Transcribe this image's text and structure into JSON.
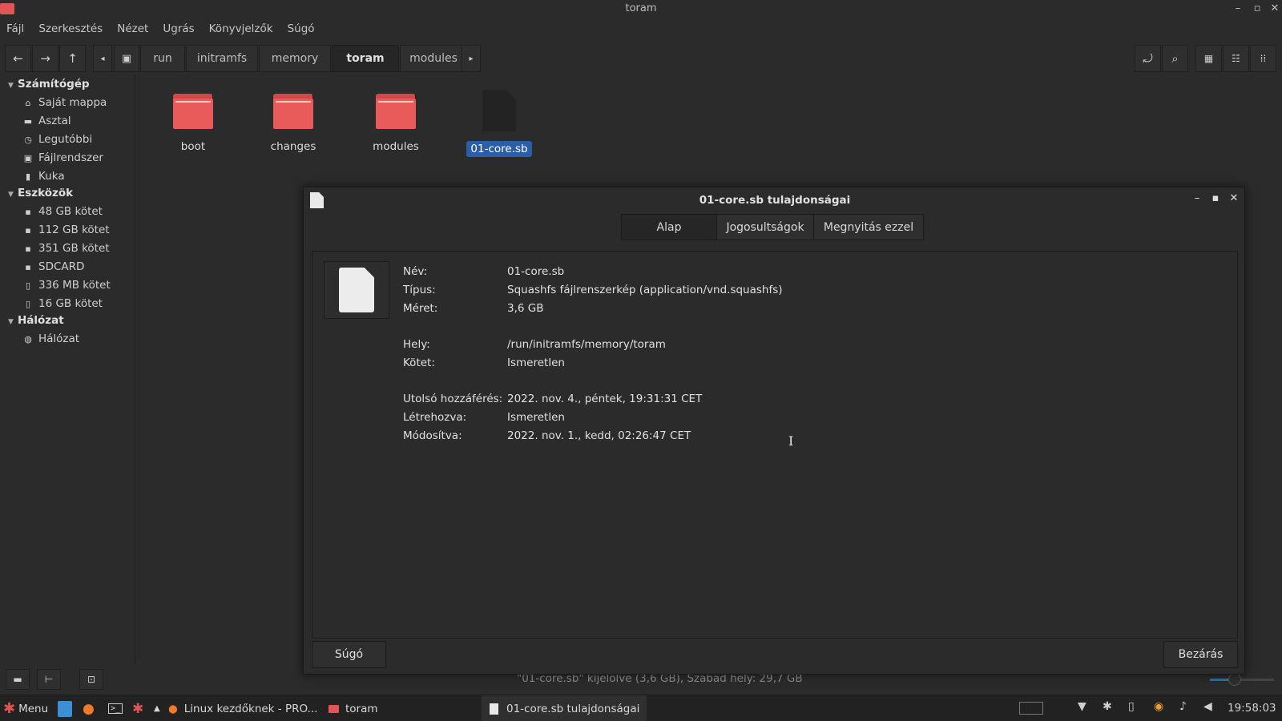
{
  "window": {
    "title": "toram"
  },
  "menu": [
    "Fájl",
    "Szerkesztés",
    "Nézet",
    "Ugrás",
    "Könyvjelzők",
    "Súgó"
  ],
  "breadcrumb": [
    "run",
    "initramfs",
    "memory",
    "toram",
    "modules"
  ],
  "sidebar": {
    "sections": [
      {
        "title": "Számítógép",
        "items": [
          "Saját mappa",
          "Asztal",
          "Legutóbbi",
          "Fájlrendszer",
          "Kuka"
        ]
      },
      {
        "title": "Eszközök",
        "items": [
          "48 GB kötet",
          "112 GB kötet",
          "351 GB kötet",
          "SDCARD",
          "336 MB kötet",
          "16 GB kötet"
        ]
      },
      {
        "title": "Hálózat",
        "items": [
          "Hálózat"
        ]
      }
    ]
  },
  "files": [
    {
      "name": "boot",
      "type": "folder"
    },
    {
      "name": "changes",
      "type": "folder"
    },
    {
      "name": "modules",
      "type": "folder"
    },
    {
      "name": "01-core.sb",
      "type": "file",
      "selected": true
    }
  ],
  "status": {
    "text": "\"01-core.sb\" kijelölve (3,6 GB), Szabad hely: 29,7 GB"
  },
  "dialog": {
    "title": "01-core.sb tulajdonságai",
    "tabs": [
      "Alap",
      "Jogosultságok",
      "Megnyitás ezzel"
    ],
    "active_tab": "Alap",
    "props": [
      {
        "label": "Név:",
        "value": "01-core.sb"
      },
      {
        "label": "Típus:",
        "value": "Squashfs fájlrenszerkép (application/vnd.squashfs)"
      },
      {
        "label": "Méret:",
        "value": "3,6 GB"
      },
      {
        "label": "Hely:",
        "value": "/run/initramfs/memory/toram"
      },
      {
        "label": "Kötet:",
        "value": "Ismeretlen"
      },
      {
        "label": "Utolsó hozzáférés:",
        "value": "2022. nov. 4., péntek, 19:31:31 CET"
      },
      {
        "label": "Létrehozva:",
        "value": "Ismeretlen"
      },
      {
        "label": "Módosítva:",
        "value": "2022. nov. 1., kedd, 02:26:47 CET"
      }
    ],
    "help_button": "Súgó",
    "close_button": "Bezárás"
  },
  "taskbar": {
    "menu_label": "Menu",
    "tasks": [
      "Linux kezdőknek - PRO...",
      "toram",
      "01-core.sb tulajdonságai"
    ],
    "clock": "19:58:03"
  },
  "colors": {
    "accent": "#2a5ea8",
    "folder": "#e85a5a",
    "background": "#2b2b2b"
  }
}
